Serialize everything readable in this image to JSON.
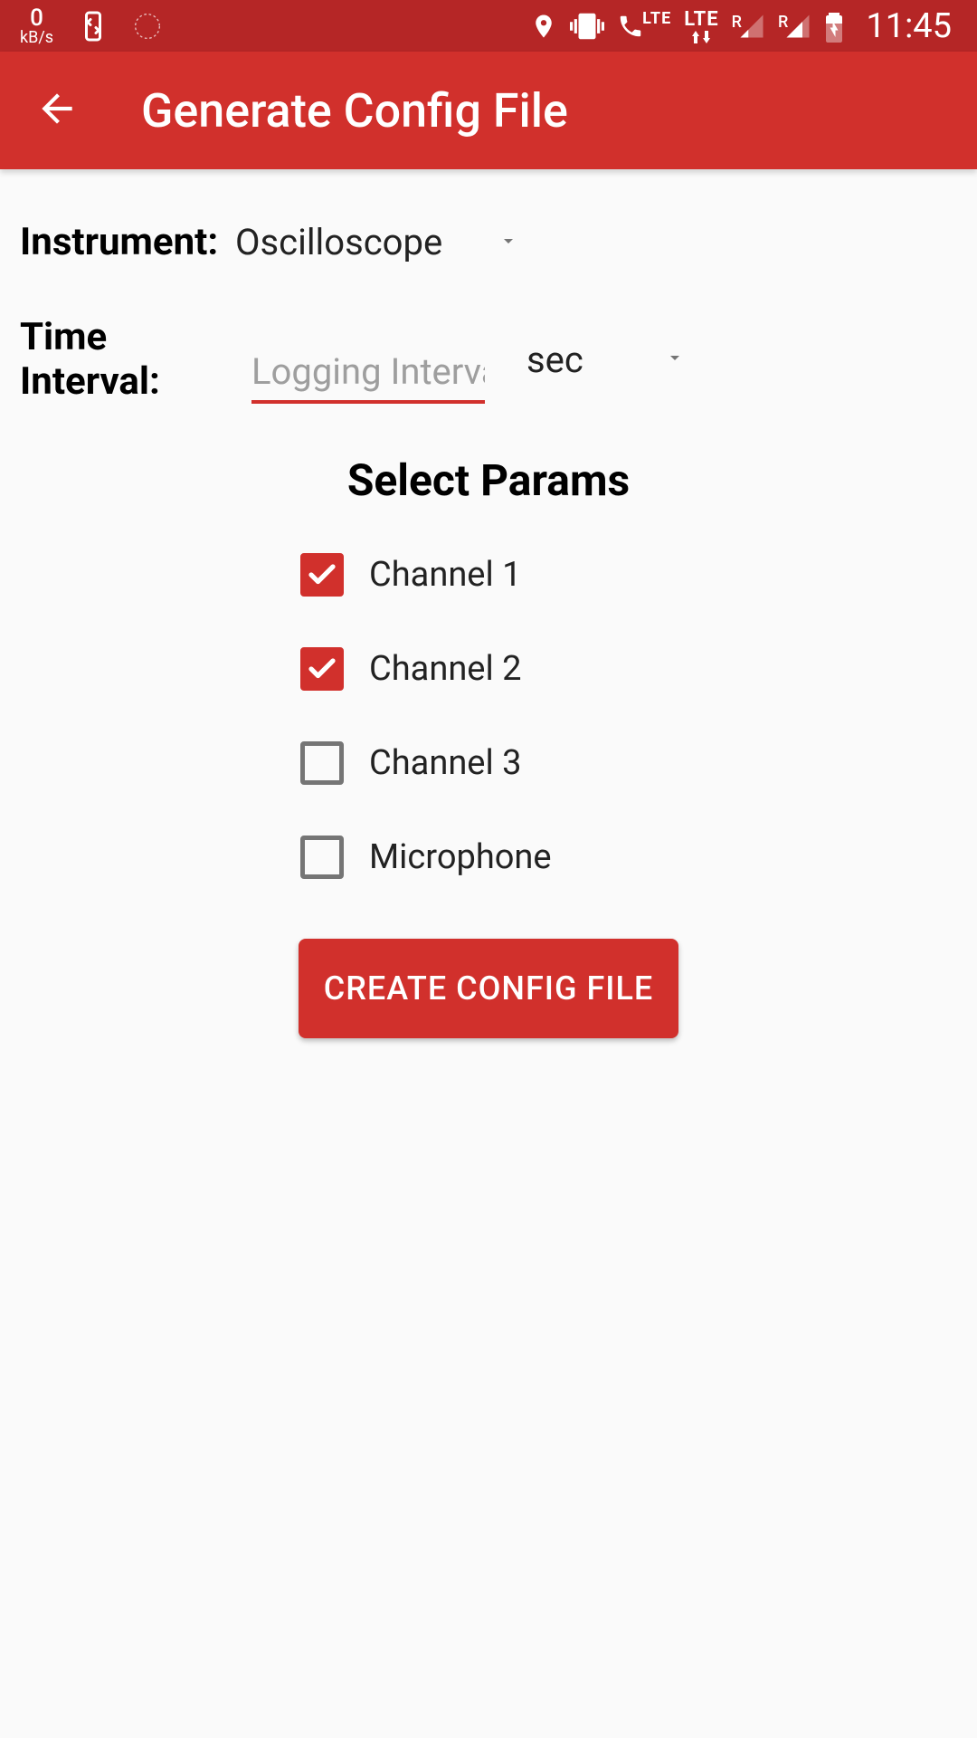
{
  "status_bar": {
    "data_rate_value": "0",
    "data_rate_unit": "kB/s",
    "lte1": "LTE",
    "lte2": "LTE",
    "r1": "R",
    "r2": "R",
    "time": "11:45"
  },
  "app_bar": {
    "title": "Generate Config File"
  },
  "form": {
    "instrument_label": "Instrument:",
    "instrument_value": "Oscilloscope",
    "interval_label": "Time Interval:",
    "interval_placeholder": "Logging Interval",
    "interval_value": "",
    "unit_value": "sec"
  },
  "params": {
    "heading": "Select Params",
    "items": [
      {
        "label": "Channel 1",
        "checked": true
      },
      {
        "label": "Channel 2",
        "checked": true
      },
      {
        "label": "Channel 3",
        "checked": false
      },
      {
        "label": "Microphone",
        "checked": false
      }
    ]
  },
  "action": {
    "button_label": "CREATE CONFIG FILE"
  },
  "colors": {
    "primary": "#d1302c",
    "status_bar": "#b52626",
    "background": "#fafafa"
  }
}
